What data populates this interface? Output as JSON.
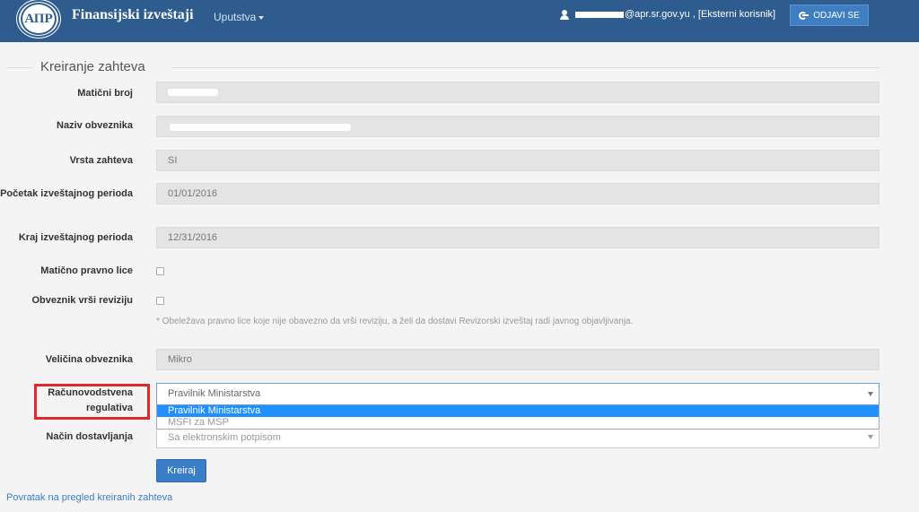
{
  "navbar": {
    "logo_text": "АПР",
    "brand": "Finansijski izveštaji",
    "menu_label": "Uputstva",
    "user_text": "@apr.sr.gov.yu , [Eksterni korisnik]",
    "logout_label": "ODJAVI SE"
  },
  "form": {
    "title": "Kreiranje zahteva",
    "fields": {
      "maticni_broj_label": "Matični broj",
      "naziv_label": "Naziv obveznika",
      "vrsta_label": "Vrsta zahteva",
      "vrsta_value": "SI",
      "pocetak_label": "Početak izveštajnog perioda",
      "pocetak_value": "01/01/2016",
      "kraj_label": "Kraj izveštajnog perioda",
      "kraj_value": "12/31/2016",
      "maticno_label": "Matično pravno lice",
      "revizija_label": "Obveznik vrši reviziju",
      "note": "* Obeležava pravno lice koje nije obavezno da vrši reviziju, a želi da dostavi Revizorski izveštaj radi javnog objavljivanja.",
      "velicina_label": "Veličina obveznika",
      "velicina_value": "Mikro",
      "regulativa_label": "Računovodstvena regulativa",
      "regulativa_value": "Pravilnik Ministarstva",
      "regulativa_options": [
        "Pravilnik Ministarstva",
        "MSFI za MSP"
      ],
      "nacin_label": "Način dostavljanja",
      "nacin_value": "Sa elektronskim potpisom"
    },
    "create_label": "Kreiraj",
    "back_link": "Povratak na pregled kreiranih zahteva"
  },
  "colors": {
    "navbar": "#2e5c8f",
    "primary": "#3a7ec8",
    "highlight": "#e02a2a",
    "selected_option": "#1e90ff"
  }
}
